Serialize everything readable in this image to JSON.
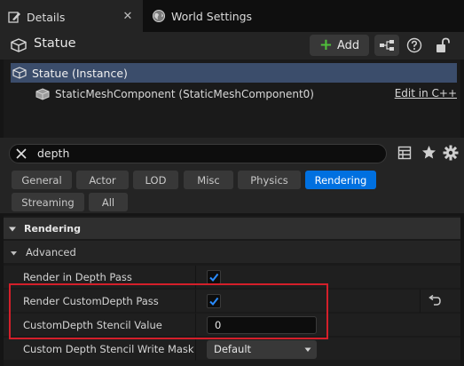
{
  "tabs": [
    {
      "label": "Details",
      "icon": "pencil-icon",
      "active": true
    },
    {
      "label": "World Settings",
      "icon": "globe-icon",
      "active": false
    }
  ],
  "header": {
    "title": "Statue",
    "add_label": "Add"
  },
  "components": {
    "instance_label": "Statue (Instance)",
    "component_label": "StaticMeshComponent (StaticMeshComponent0)",
    "edit_link": "Edit in C++"
  },
  "search": {
    "value": "depth"
  },
  "filters": [
    "General",
    "Actor",
    "LOD",
    "Misc",
    "Physics",
    "Rendering",
    "Streaming",
    "All"
  ],
  "active_filter": "Rendering",
  "details": {
    "category": "Rendering",
    "subcategory": "Advanced",
    "properties": [
      {
        "label": "Render in Depth Pass",
        "type": "checkbox",
        "checked": true
      },
      {
        "label": "Render CustomDepth Pass",
        "type": "checkbox",
        "checked": true
      },
      {
        "label": "CustomDepth Stencil Value",
        "type": "number",
        "value": "0"
      },
      {
        "label": "Custom Depth Stencil Write Mask",
        "type": "dropdown",
        "value": "Default"
      }
    ]
  },
  "colors": {
    "accent": "#0070e0",
    "selection": "#3b4d6b",
    "highlight": "#d41f2a",
    "add_plus": "#4fbf3a"
  }
}
